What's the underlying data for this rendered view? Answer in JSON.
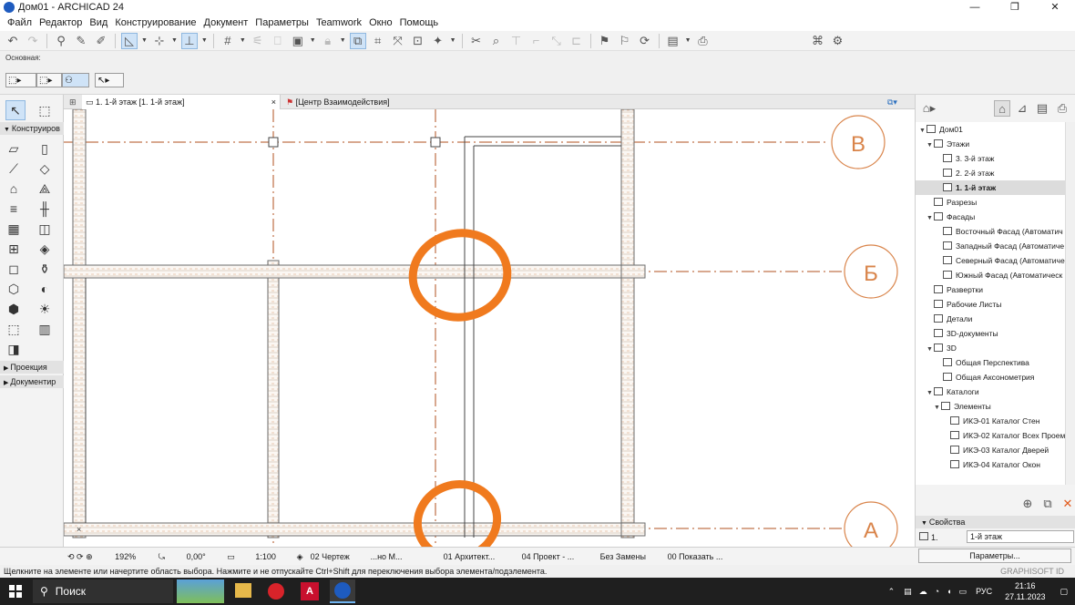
{
  "window": {
    "title": "Дом01 - ARCHICAD 24",
    "minimize": "—",
    "maximize": "❐",
    "close": "✕"
  },
  "menu": [
    "Файл",
    "Редактор",
    "Вид",
    "Конструирование",
    "Документ",
    "Параметры",
    "Teamwork",
    "Окно",
    "Помощь"
  ],
  "infobox": {
    "label": "Основная:"
  },
  "toolbox": {
    "sections": [
      "Конструиров",
      "Проекция",
      "Документир"
    ]
  },
  "tabs": [
    {
      "label": "1. 1-й этаж [1. 1-й этаж]",
      "close": "×"
    },
    {
      "label": "[Центр Взаимодействия]"
    }
  ],
  "drawing": {
    "grid_labels": [
      "В",
      "Б",
      "А"
    ],
    "colors": {
      "axis": "#b0521f",
      "wall": "#6b6b6b",
      "marker": "#f07a1e",
      "bubble": "#d9844a"
    }
  },
  "navigator": {
    "tree": [
      {
        "label": "Дом01",
        "level": 0,
        "expanded": true
      },
      {
        "label": "Этажи",
        "level": 1,
        "expanded": true
      },
      {
        "label": "3. 3-й этаж",
        "level": 2
      },
      {
        "label": "2. 2-й этаж",
        "level": 2
      },
      {
        "label": "1. 1-й этаж",
        "level": 2,
        "selected": true
      },
      {
        "label": "Разрезы",
        "level": 1
      },
      {
        "label": "Фасады",
        "level": 1,
        "expanded": true
      },
      {
        "label": "Восточный Фасад (Автоматич",
        "level": 2
      },
      {
        "label": "Западный Фасад (Автоматиче",
        "level": 2
      },
      {
        "label": "Северный Фасад (Автоматиче",
        "level": 2
      },
      {
        "label": "Южный Фасад (Автоматическ",
        "level": 2
      },
      {
        "label": "Развертки",
        "level": 1
      },
      {
        "label": "Рабочие Листы",
        "level": 1
      },
      {
        "label": "Детали",
        "level": 1
      },
      {
        "label": "3D-документы",
        "level": 1
      },
      {
        "label": "3D",
        "level": 1,
        "expanded": true
      },
      {
        "label": "Общая Перспектива",
        "level": 2
      },
      {
        "label": "Общая Аксонометрия",
        "level": 2
      },
      {
        "label": "Каталоги",
        "level": 1,
        "expanded": true
      },
      {
        "label": "Элементы",
        "level": 2,
        "expanded": true
      },
      {
        "label": "ИКЭ-01 Каталог Стен",
        "level": 3
      },
      {
        "label": "ИКЭ-02 Каталог Всех Проем",
        "level": 3
      },
      {
        "label": "ИКЭ-03 Каталог Дверей",
        "level": 3
      },
      {
        "label": "ИКЭ-04 Каталог Окон",
        "level": 3
      }
    ],
    "properties": {
      "header": "Свойства",
      "id_label": "1.",
      "id_value": "1-й этаж",
      "button": "Параметры..."
    }
  },
  "bottombar": {
    "zoom": "192%",
    "angle": "0,00°",
    "scale": "1:100",
    "layer_combo": "02 Чертеж",
    "model_view": "...но М...",
    "pen_set": "01 Архитект...",
    "structure": "04 Проект - ...",
    "override": "Без Замены",
    "renovation": "00 Показать ..."
  },
  "status": {
    "text": "Щелкните на элементе или начертите область выбора. Нажмите и не отпускайте Ctrl+Shift для переключения выбора элемента/подэлемента.",
    "brand": "GRAPHISOFT ID"
  },
  "taskbar": {
    "search": "Поиск",
    "lang": "РУС",
    "time": "21:16",
    "date": "27.11.2023"
  }
}
